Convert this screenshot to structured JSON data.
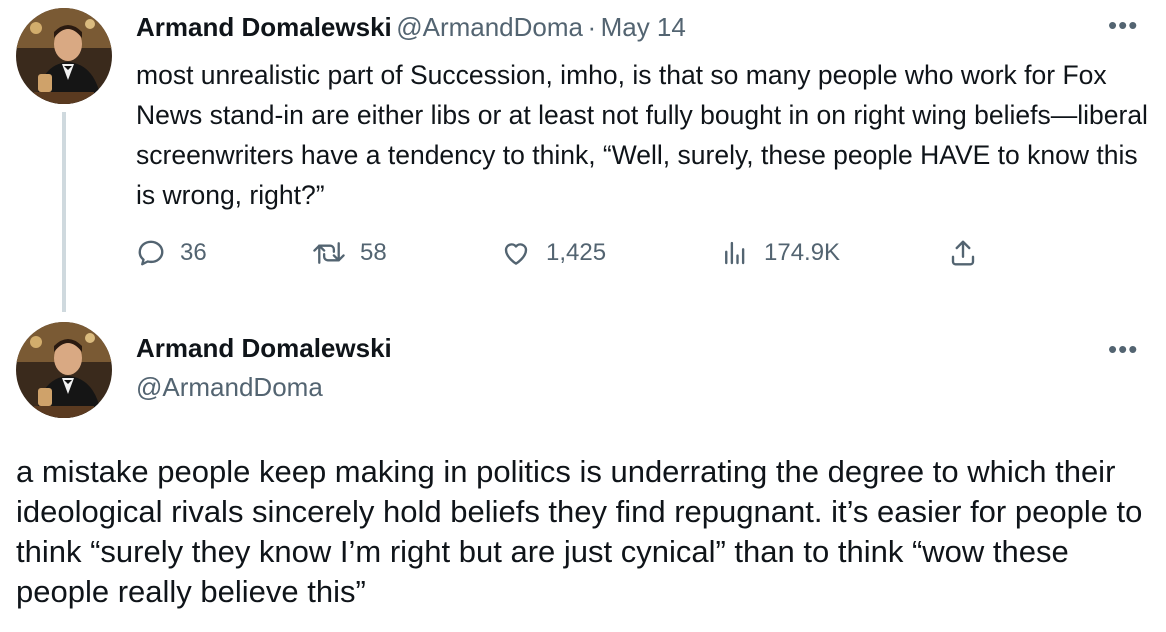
{
  "tweet1": {
    "author_name": "Armand Domalewski",
    "author_handle": "@ArmandDoma",
    "separator": "·",
    "date": "May 14",
    "more_label": "•••",
    "text": "most unrealistic part of Succession, imho, is that so many people who work for Fox News stand-in are either libs or at least not fully bought in on right wing beliefs—liberal screenwriters have a tendency to think, “Well, surely, these people HAVE to know this is wrong, right?”",
    "actions": {
      "replies": "36",
      "retweets": "58",
      "likes": "1,425",
      "views": "174.9K"
    },
    "icons": [
      "reply-icon",
      "retweet-icon",
      "like-icon",
      "views-icon",
      "share-icon"
    ]
  },
  "tweet2": {
    "author_name": "Armand Domalewski",
    "author_handle": "@ArmandDoma",
    "more_label": "•••",
    "text": "a mistake people keep making in politics is underrating the degree to which their ideological rivals sincerely hold beliefs they find repugnant. it’s easier for people to think “surely they know I’m right but are just cynical” than to think “wow these people really believe this”"
  },
  "colors": {
    "text_primary": "#0f1419",
    "text_secondary": "#536471",
    "thread_line": "#cfd9de",
    "background": "#ffffff"
  }
}
